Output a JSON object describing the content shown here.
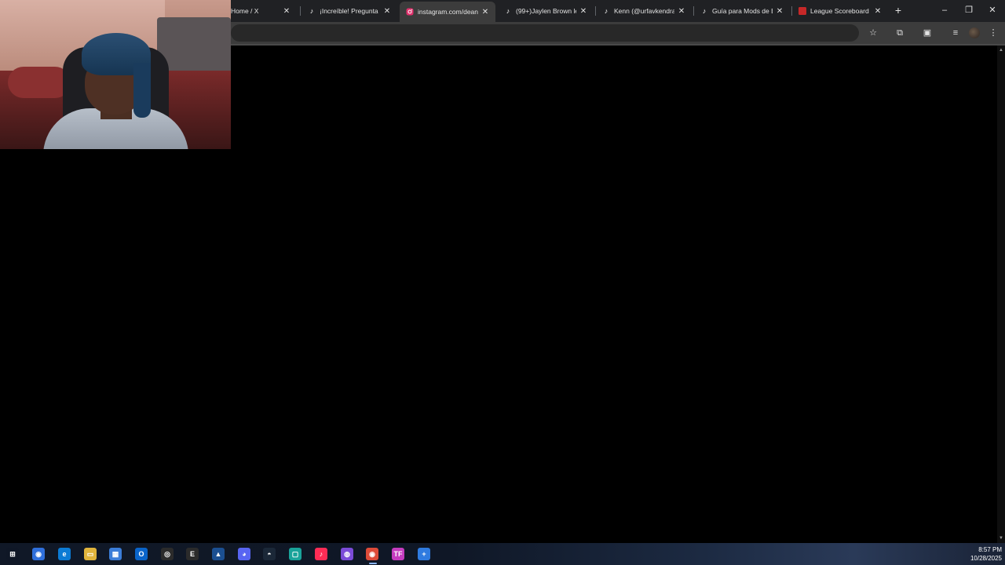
{
  "browser": {
    "tabs": [
      {
        "title": "Home / X",
        "favicon": "x-icon",
        "active": false
      },
      {
        "title": "¡Increíble! Pregunta",
        "favicon": "tiktok-icon",
        "active": false
      },
      {
        "title": "instagram.com/dean",
        "favicon": "instagram-icon",
        "active": true
      },
      {
        "title": "(99+)Jaylen Brown le",
        "favicon": "tiktok-icon",
        "active": false
      },
      {
        "title": "Kenn (@urfavkendra",
        "favicon": "tiktok-icon",
        "active": false
      },
      {
        "title": "Guía para Mods de B",
        "favicon": "tiktok-icon",
        "active": false
      },
      {
        "title": "League Scoreboard -",
        "favicon": "scoreboard-icon",
        "active": false
      }
    ],
    "new_tab_glyph": "+",
    "window_controls": {
      "minimize": "–",
      "restore": "❐",
      "close": "✕"
    },
    "toolbar_icons": {
      "bookmark": "☆",
      "extensions": "⧉",
      "side_panel": "▣",
      "media": "≡",
      "menu": "⋮"
    },
    "address": ""
  },
  "colors": {
    "tabstrip_bg": "#202124",
    "toolbar_bg": "#3c3c3c",
    "page_bg": "#000000",
    "instagram": "#e1306c",
    "tiktok": "#ffffff",
    "scoreboard": "#c62828"
  },
  "taskbar": {
    "apps": [
      {
        "name": "windows-start-icon",
        "glyph": "⊞",
        "color": "#0f1726"
      },
      {
        "name": "copilot-icon",
        "glyph": "◉",
        "color": "#2f6fdb"
      },
      {
        "name": "edge-icon",
        "glyph": "e",
        "color": "#0c7bd4"
      },
      {
        "name": "file-explorer-icon",
        "glyph": "▭",
        "color": "#e0b43c"
      },
      {
        "name": "ms-store-icon",
        "glyph": "▦",
        "color": "#3b7dd8"
      },
      {
        "name": "outlook-icon",
        "glyph": "O",
        "color": "#0a64c9"
      },
      {
        "name": "obs-icon",
        "glyph": "◎",
        "color": "#2b2b2b"
      },
      {
        "name": "epic-games-icon",
        "glyph": "E",
        "color": "#2b2b2b"
      },
      {
        "name": "arc-icon",
        "glyph": "▲",
        "color": "#1b4f91"
      },
      {
        "name": "discord-icon",
        "glyph": "◕",
        "color": "#5865f2"
      },
      {
        "name": "steam-icon",
        "glyph": "◓",
        "color": "#1b2838"
      },
      {
        "name": "capcut-icon",
        "glyph": "▢",
        "color": "#1aa39a"
      },
      {
        "name": "tiktok-icon",
        "glyph": "♪",
        "color": "#fe2c55"
      },
      {
        "name": "podcast-icon",
        "glyph": "◍",
        "color": "#7b4bd8"
      },
      {
        "name": "chrome-icon",
        "glyph": "◉",
        "color": "#dd4b39"
      },
      {
        "name": "tf-icon",
        "glyph": "TF",
        "color": "#c43cbf"
      },
      {
        "name": "add-app-icon",
        "glyph": "+",
        "color": "#2f7be0"
      }
    ],
    "time": "8:57 PM",
    "date": "10/28/2025"
  }
}
